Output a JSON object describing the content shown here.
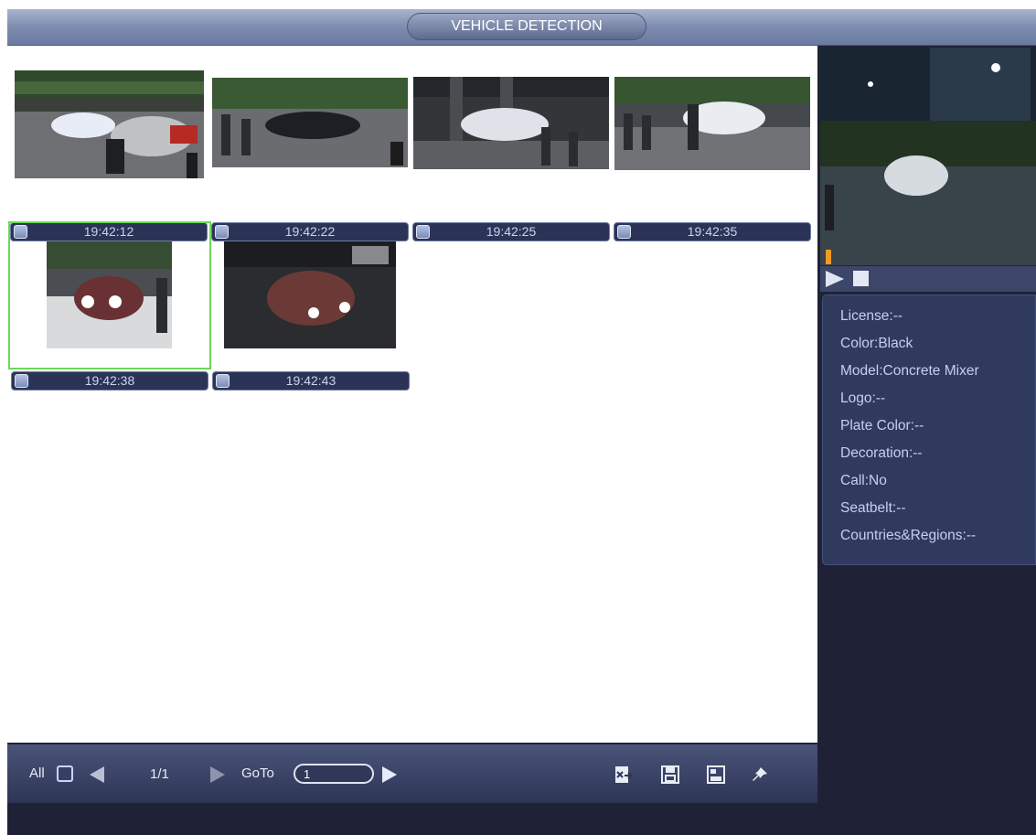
{
  "header": {
    "title": "VEHICLE DETECTION"
  },
  "thumbnails": [
    {
      "time": "19:42:12",
      "selected": false
    },
    {
      "time": "19:42:22",
      "selected": false
    },
    {
      "time": "19:42:25",
      "selected": false
    },
    {
      "time": "19:42:35",
      "selected": false
    },
    {
      "time": "19:42:38",
      "selected": true
    },
    {
      "time": "19:42:43",
      "selected": false
    }
  ],
  "toolbar": {
    "all_label": "All",
    "page": "1/1",
    "goto_label": "GoTo",
    "goto_value": "1",
    "icons": [
      "export-icon",
      "save-icon",
      "backup-icon",
      "pin-icon"
    ]
  },
  "details": {
    "license": "License:--",
    "color": "Color:Black",
    "model": "Model:Concrete Mixer",
    "logo": "Logo:--",
    "plate_color": "Plate Color:--",
    "decoration": "Decoration:--",
    "call": "Call:No",
    "seatbelt": "Seatbelt:--",
    "countries": "Countries&Regions:--"
  },
  "colors": {
    "header": "#7d8cb0",
    "panel_dark": "#1f2236",
    "info_panel": "#2f3a5e",
    "selection": "#6ed65a",
    "progress_marker": "#f39b1f"
  }
}
